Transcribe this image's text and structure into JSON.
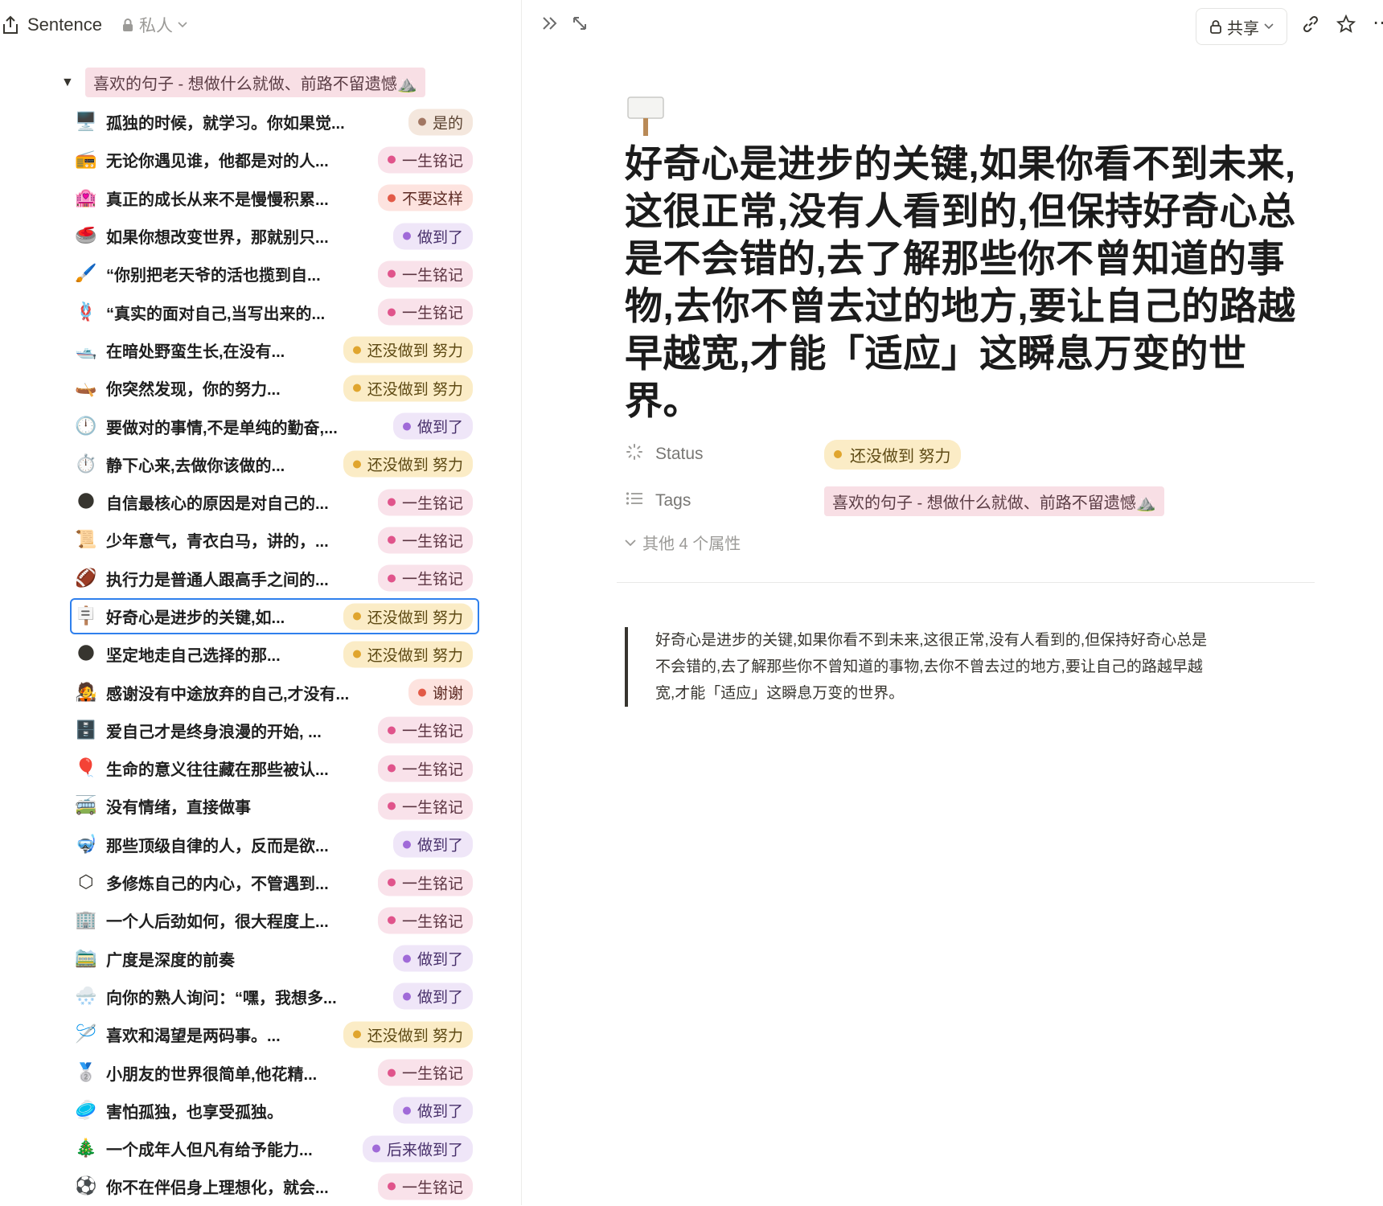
{
  "header": {
    "app_title": "Sentence",
    "privacy_label": "私人",
    "share_label": "共享"
  },
  "group": {
    "label": "喜欢的句子 - 想做什么就做、前路不留遗憾⛰️"
  },
  "items": [
    {
      "emoji": "🖥️",
      "text": "孤独的时候，就学习。你如果觉...",
      "tag": "是的",
      "tag_bg": "#f4e7dd",
      "tag_fg": "#5a4230",
      "dot": "#a27763"
    },
    {
      "emoji": "📻",
      "text": "无论你遇见谁，他都是对的人...",
      "tag": "一生铭记",
      "tag_bg": "#f9e2ea",
      "tag_fg": "#5c3441",
      "dot": "#e0548b"
    },
    {
      "emoji": "🏩",
      "text": "真正的成长从来不是慢慢积累...",
      "tag": "不要这样",
      "tag_bg": "#fde3df",
      "tag_fg": "#5d2b24",
      "dot": "#e25a47"
    },
    {
      "emoji": "🥌",
      "text": "如果你想改变世界，那就别只...",
      "tag": "做到了",
      "tag_bg": "#efe6f8",
      "tag_fg": "#48306b",
      "dot": "#a06ad8"
    },
    {
      "emoji": "🖌️",
      "text": "“你别把老天爷的活也揽到自...",
      "tag": "一生铭记",
      "tag_bg": "#f9e2ea",
      "tag_fg": "#5c3441",
      "dot": "#e0548b"
    },
    {
      "emoji": "🪢",
      "text": "“真实的面对自己,当写出来的...",
      "tag": "一生铭记",
      "tag_bg": "#f9e2ea",
      "tag_fg": "#5c3441",
      "dot": "#e0548b"
    },
    {
      "emoji": "🛥️",
      "text": "在暗处野蛮生长,在没有...",
      "tag": "还没做到 努力",
      "tag_bg": "#fbecc6",
      "tag_fg": "#5e4a14",
      "dot": "#e0a52d"
    },
    {
      "emoji": "🛶",
      "text": "你突然发现，你的努力...",
      "tag": "还没做到 努力",
      "tag_bg": "#fbecc6",
      "tag_fg": "#5e4a14",
      "dot": "#e0a52d"
    },
    {
      "emoji": "🕛",
      "text": "要做对的事情,不是单纯的勤奋,...",
      "tag": "做到了",
      "tag_bg": "#efe6f8",
      "tag_fg": "#48306b",
      "dot": "#a06ad8"
    },
    {
      "emoji": "⏱️",
      "text": "静下心来,去做你该做的...",
      "tag": "还没做到 努力",
      "tag_bg": "#fbecc6",
      "tag_fg": "#5e4a14",
      "dot": "#e0a52d"
    },
    {
      "emoji": "🌑",
      "text": "自信最核心的原因是对自己的...",
      "tag": "一生铭记",
      "tag_bg": "#f9e2ea",
      "tag_fg": "#5c3441",
      "dot": "#e0548b"
    },
    {
      "emoji": "📜",
      "text": "少年意气，青衣白马，讲的，...",
      "tag": "一生铭记",
      "tag_bg": "#f9e2ea",
      "tag_fg": "#5c3441",
      "dot": "#e0548b"
    },
    {
      "emoji": "🏈",
      "text": "执行力是普通人跟高手之间的...",
      "tag": "一生铭记",
      "tag_bg": "#f9e2ea",
      "tag_fg": "#5c3441",
      "dot": "#e0548b"
    },
    {
      "emoji": "🪧",
      "text": "好奇心是进步的关键,如...",
      "tag": "还没做到 努力",
      "tag_bg": "#fbecc6",
      "tag_fg": "#5e4a14",
      "dot": "#e0a52d",
      "selected": true
    },
    {
      "emoji": "🌑",
      "text": "坚定地走自己选择的那...",
      "tag": "还没做到 努力",
      "tag_bg": "#fbecc6",
      "tag_fg": "#5e4a14",
      "dot": "#e0a52d"
    },
    {
      "emoji": "🧑‍🎤",
      "text": "感谢没有中途放弃的自己,才没有...",
      "tag": "谢谢",
      "tag_bg": "#fde3df",
      "tag_fg": "#5d2b24",
      "dot": "#e25a47"
    },
    {
      "emoji": "🗄️",
      "text": "爱自己才是终身浪漫的开始, ...",
      "tag": "一生铭记",
      "tag_bg": "#f9e2ea",
      "tag_fg": "#5c3441",
      "dot": "#e0548b"
    },
    {
      "emoji": "🎈",
      "text": "生命的意义往往藏在那些被认...",
      "tag": "一生铭记",
      "tag_bg": "#f9e2ea",
      "tag_fg": "#5c3441",
      "dot": "#e0548b"
    },
    {
      "emoji": "🚎",
      "text": "没有情绪，直接做事",
      "tag": "一生铭记",
      "tag_bg": "#f9e2ea",
      "tag_fg": "#5c3441",
      "dot": "#e0548b"
    },
    {
      "emoji": "🤿",
      "text": "那些顶级自律的人，反而是欲...",
      "tag": "做到了",
      "tag_bg": "#efe6f8",
      "tag_fg": "#48306b",
      "dot": "#a06ad8"
    },
    {
      "emoji": "⬡",
      "text": "多修炼自己的内心，不管遇到...",
      "tag": "一生铭记",
      "tag_bg": "#f9e2ea",
      "tag_fg": "#5c3441",
      "dot": "#e0548b"
    },
    {
      "emoji": "🏢",
      "text": "一个人后劲如何，很大程度上...",
      "tag": "一生铭记",
      "tag_bg": "#f9e2ea",
      "tag_fg": "#5c3441",
      "dot": "#e0548b"
    },
    {
      "emoji": "🚞",
      "text": "广度是深度的前奏",
      "tag": "做到了",
      "tag_bg": "#efe6f8",
      "tag_fg": "#48306b",
      "dot": "#a06ad8"
    },
    {
      "emoji": "🌨️",
      "text": "向你的熟人询问：“嘿，我想多...",
      "tag": "做到了",
      "tag_bg": "#efe6f8",
      "tag_fg": "#48306b",
      "dot": "#a06ad8"
    },
    {
      "emoji": "🪡",
      "text": "喜欢和渴望是两码事。...",
      "tag": "还没做到 努力",
      "tag_bg": "#fbecc6",
      "tag_fg": "#5e4a14",
      "dot": "#e0a52d"
    },
    {
      "emoji": "🥈",
      "text": "小朋友的世界很简单,他花精...",
      "tag": "一生铭记",
      "tag_bg": "#f9e2ea",
      "tag_fg": "#5c3441",
      "dot": "#e0548b"
    },
    {
      "emoji": "🥏",
      "text": "害怕孤独，也享受孤独。",
      "tag": "做到了",
      "tag_bg": "#efe6f8",
      "tag_fg": "#48306b",
      "dot": "#a06ad8"
    },
    {
      "emoji": "🎄",
      "text": "一个成年人但凡有给予能力...",
      "tag": "后来做到了",
      "tag_bg": "#efe6f8",
      "tag_fg": "#48306b",
      "dot": "#a06ad8"
    },
    {
      "emoji": "⚽",
      "text": "你不在伴侣身上理想化，就会...",
      "tag": "一生铭记",
      "tag_bg": "#f9e2ea",
      "tag_fg": "#5c3441",
      "dot": "#e0548b"
    }
  ],
  "page": {
    "icon": "signpost-icon",
    "title": "好奇心是进步的关键,如果你看不到未来,这很正常,没有人看到的,但保持好奇心总是不会错的,去了解那些你不曾知道的事物,去你不曾去过的地方,要让自己的路越早越宽,才能「适应」这瞬息万变的世界。",
    "properties": {
      "status_name": "Status",
      "status_value": "还没做到 努力",
      "tags_name": "Tags",
      "tags_value": "喜欢的句子 - 想做什么就做、前路不留遗憾⛰️",
      "more_label": "其他 4 个属性"
    },
    "quote_lines": [
      "好奇心是进步的关键,如果你看不到未来,这很正常,没有人看到的,但保持好奇心总是",
      "不会错的,去了解那些你不曾知道的事物,去你不曾去过的地方,要让自己的路越早越",
      "宽,才能「适应」这瞬息万变的世界。"
    ]
  },
  "colors": {
    "accent": "#2f80ed",
    "status_dot": "#e0a52d"
  }
}
